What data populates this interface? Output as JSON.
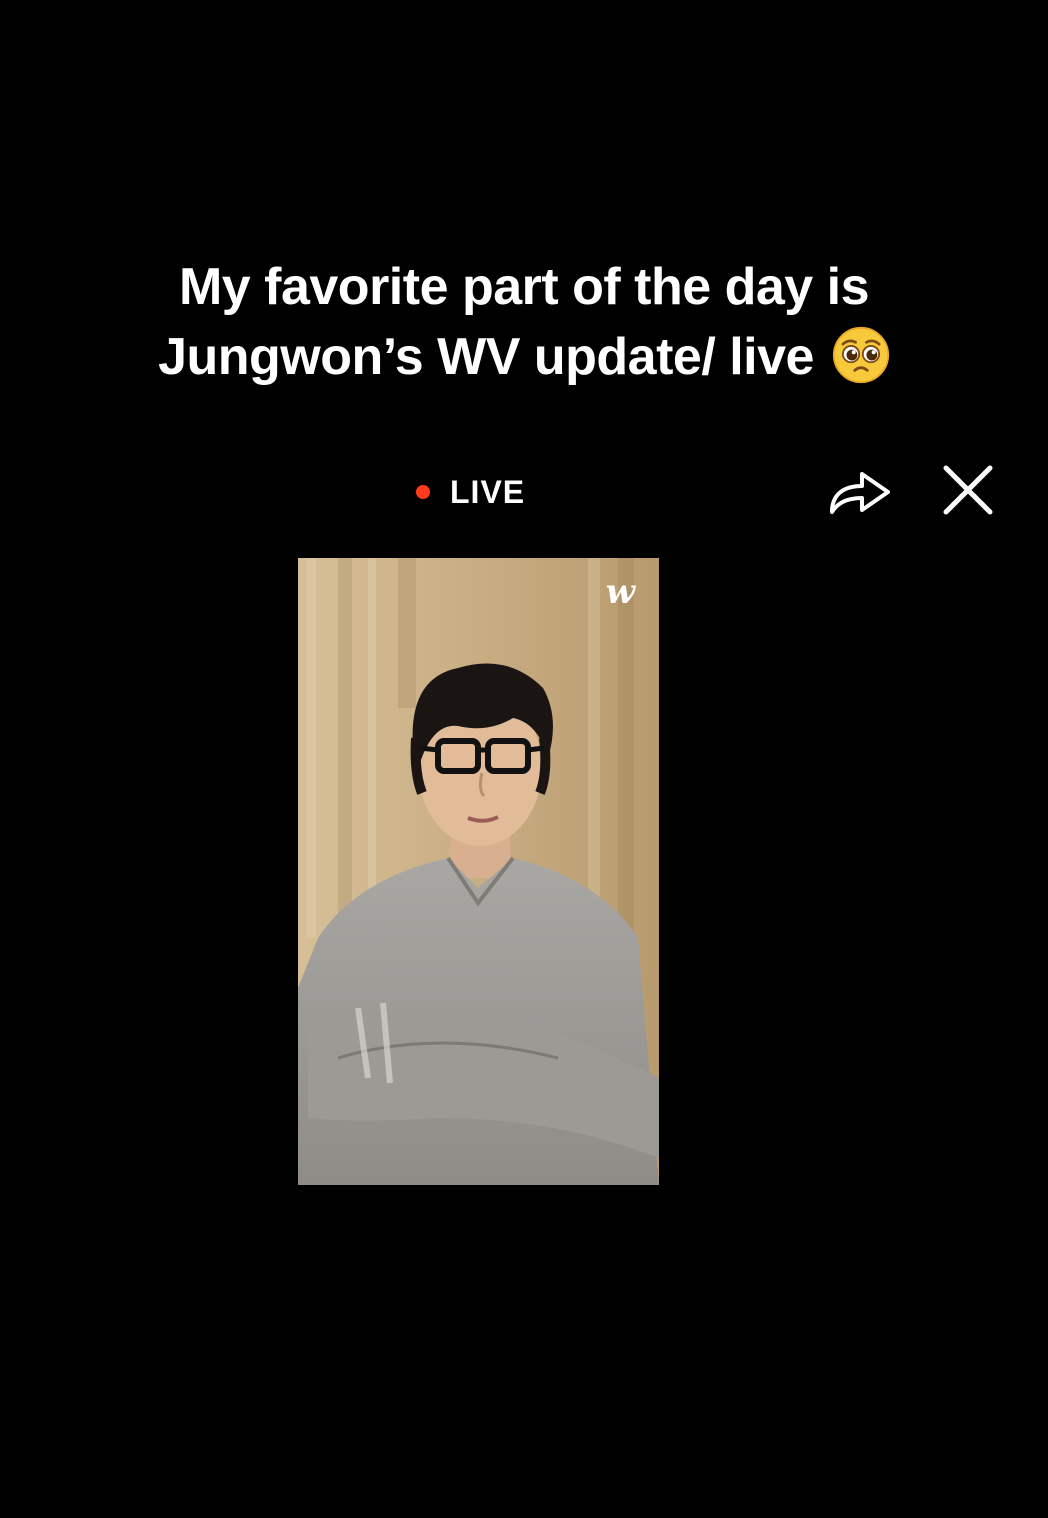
{
  "caption": {
    "line1": "My favorite part of the day is",
    "line2": "Jungwon’s WV update/ live",
    "emoji": "pleading-face-emoji"
  },
  "header": {
    "live_label": "LIVE",
    "live_color": "#ff3b1a",
    "share_icon": "share-arrow-icon",
    "close_icon": "close-x-icon"
  },
  "video": {
    "logo_text": "w",
    "logo_icon": "weverse-logo"
  },
  "colors": {
    "background": "#000000",
    "text": "#ffffff"
  }
}
